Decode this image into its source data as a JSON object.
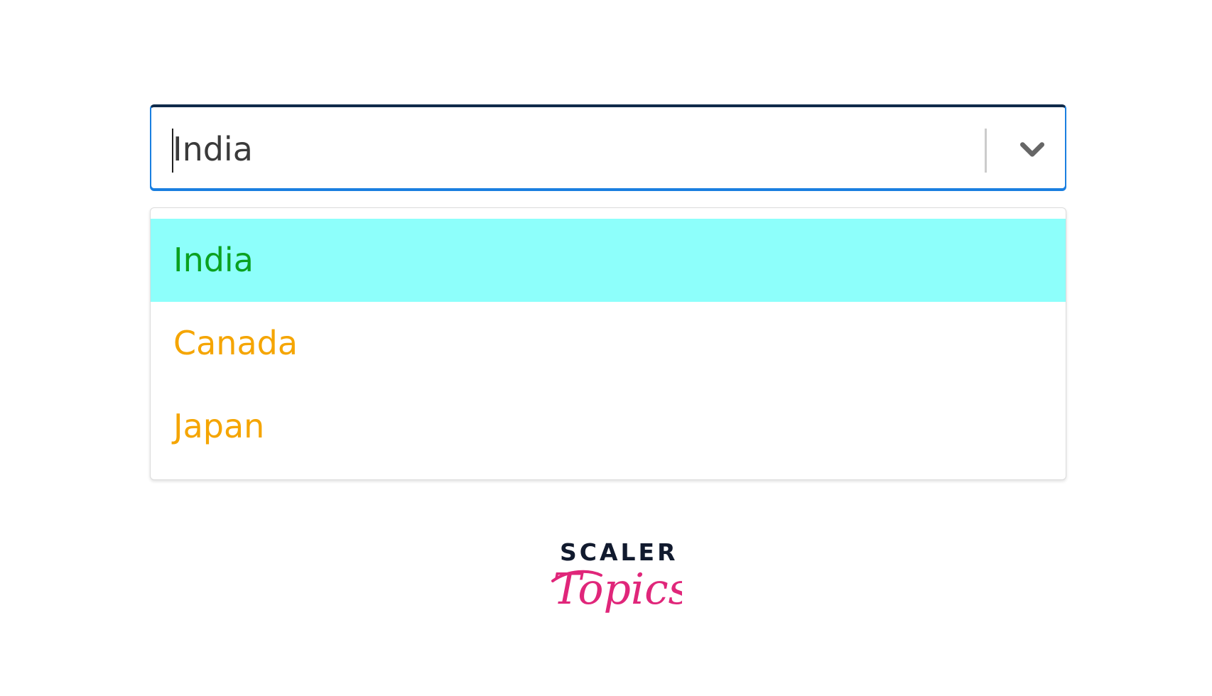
{
  "select": {
    "value": "India",
    "indicator_icon": "chevron-down-icon",
    "border_color": "#1a7fe0"
  },
  "menu": {
    "options": [
      {
        "label": "India",
        "color": "#0aa120",
        "focused": true
      },
      {
        "label": "Canada",
        "color": "#f5a500",
        "focused": false
      },
      {
        "label": "Japan",
        "color": "#f5a500",
        "focused": false
      }
    ],
    "focus_background": "#8dfffb"
  },
  "brand": {
    "name": "SCALER",
    "tagline": "Topics",
    "name_color": "#111a2e",
    "tagline_color": "#e0267a"
  }
}
